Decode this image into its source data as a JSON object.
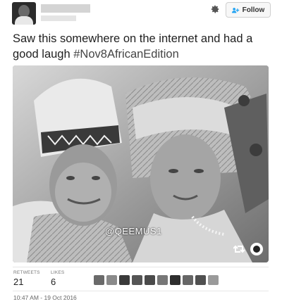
{
  "tweet": {
    "text_line1": "Saw this somewhere on the internet and had a",
    "text_line2_prefix": "good laugh ",
    "hashtag": "#Nov8AfricanEdition",
    "photo_watermark": "@QEEMUS1",
    "timestamp": "10:47 AM - 19 Oct 2016"
  },
  "header": {
    "follow_label": "Follow"
  },
  "stats": {
    "retweets_label": "RETWEETS",
    "retweets_value": "21",
    "likes_label": "LIKES",
    "likes_value": "6",
    "liker_avatar_count": 10
  },
  "icons": {
    "settings": "gear-icon",
    "follow": "add-user-icon",
    "retweet": "retweet-icon"
  },
  "colors": {
    "background": "#ffffff",
    "text": "#1f1f1f",
    "muted": "#777777"
  }
}
